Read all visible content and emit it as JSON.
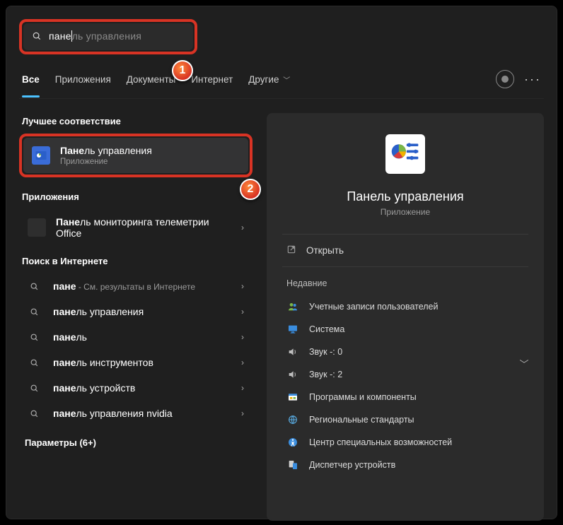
{
  "search": {
    "typed": "пане",
    "hint": "ль управления"
  },
  "tabs": {
    "all": "Все",
    "apps": "Приложения",
    "docs": "Документы",
    "web": "Интернет",
    "more": "Другие"
  },
  "sections": {
    "best": "Лучшее соответствие",
    "apps": "Приложения",
    "web": "Поиск в Интернете",
    "params": "Параметры (6+)"
  },
  "best": {
    "title_bold": "Пане",
    "title_rest": "ль управления",
    "sub": "Приложение"
  },
  "app_result": {
    "bold": "Пане",
    "rest": "ль мониторинга телеметрии Office"
  },
  "web_results": [
    {
      "bold": "пане",
      "rest": "",
      "hint": " - См. результаты в Интернете"
    },
    {
      "bold": "пане",
      "rest": "ль управления",
      "hint": ""
    },
    {
      "bold": "пане",
      "rest": "ль",
      "hint": ""
    },
    {
      "bold": "пане",
      "rest": "ль инструментов",
      "hint": ""
    },
    {
      "bold": "пане",
      "rest": "ль устройств",
      "hint": ""
    },
    {
      "bold": "пане",
      "rest": "ль управления nvidia",
      "hint": ""
    }
  ],
  "right": {
    "title": "Панель управления",
    "sub": "Приложение",
    "open": "Открыть",
    "recent_title": "Недавние",
    "recent": [
      {
        "icon": "users",
        "label": "Учетные записи пользователей"
      },
      {
        "icon": "monitor",
        "label": "Система"
      },
      {
        "icon": "speaker",
        "label": "Звук -: 0"
      },
      {
        "icon": "speaker",
        "label": "Звук -: 2"
      },
      {
        "icon": "programs",
        "label": "Программы и компоненты"
      },
      {
        "icon": "globe",
        "label": "Региональные стандарты"
      },
      {
        "icon": "access",
        "label": "Центр специальных возможностей"
      },
      {
        "icon": "devices",
        "label": "Диспетчер устройств"
      }
    ]
  },
  "markers": {
    "1": "1",
    "2": "2"
  }
}
